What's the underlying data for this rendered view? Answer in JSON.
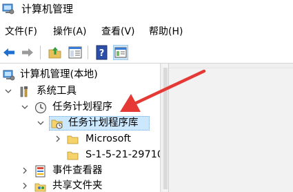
{
  "window": {
    "title": "计算机管理"
  },
  "menu": {
    "file": "文件(F)",
    "action": "操作(A)",
    "view": "查看(V)",
    "help": "帮助(H)"
  },
  "tree": {
    "root": "计算机管理(本地)",
    "system_tools": "系统工具",
    "task_scheduler": "任务计划程序",
    "task_scheduler_library": "任务计划程序库",
    "microsoft": "Microsoft",
    "sid_folder": "S-1-5-21-29710",
    "event_viewer": "事件查看器",
    "shared_folders": "共享文件夹"
  },
  "colors": {
    "annotation_arrow": "#e53935",
    "selection": "#cce8ff",
    "back_arrow": "#1e6fd0"
  },
  "icons": [
    "computer-management-icon",
    "back-arrow-icon",
    "forward-arrow-icon",
    "up-folder-icon",
    "show-hide-tree-icon",
    "help-icon",
    "properties-icon",
    "tools-icon",
    "clock-icon",
    "folder-icon",
    "event-viewer-icon",
    "shared-folders-icon"
  ]
}
